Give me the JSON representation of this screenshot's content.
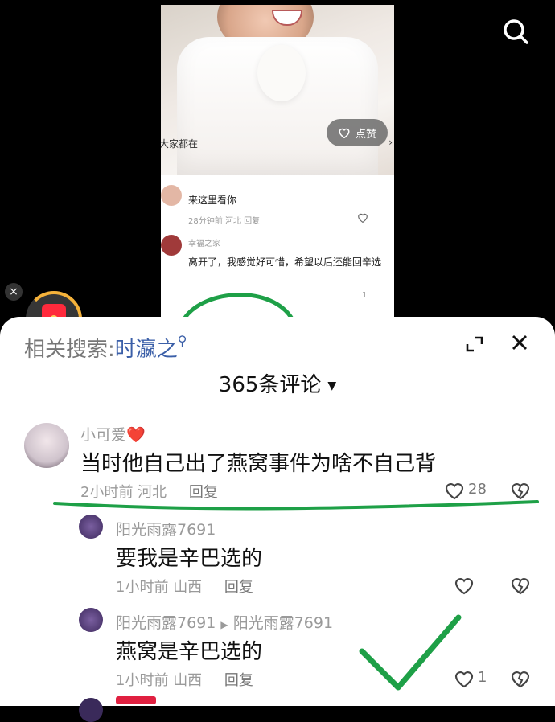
{
  "video": {
    "like_label": "点赞",
    "everyone_text": "大家都在",
    "mini_comments": [
      {
        "text": "来这里看你",
        "meta": "28分钟前 河北 回复"
      },
      {
        "user": "幸福之家",
        "text": "离开了，我感觉好可惜，希望以后还能回辛选",
        "meta": "1",
        "like_count": "1"
      }
    ]
  },
  "sheet": {
    "related_label": "相关搜索:",
    "related_keyword": "时瀛之",
    "comment_count_title": "365条评论"
  },
  "comments": [
    {
      "user": "小可爱❤️",
      "text": "当时他自己出了燕窝事件为啥不自己背",
      "time": "2小时前",
      "location": "河北",
      "reply_label": "回复",
      "likes": "28"
    },
    {
      "user": "阳光雨露7691",
      "text": "要我是辛巴选的",
      "time": "1小时前",
      "location": "山西",
      "reply_label": "回复",
      "likes": ""
    },
    {
      "user": "阳光雨露7691",
      "reply_to": "阳光雨露7691",
      "text": "燕窝是辛巴选的",
      "time": "1小时前",
      "location": "山西",
      "reply_label": "回复",
      "likes": "1"
    }
  ],
  "colors": {
    "accent_blue": "#3b5fa8",
    "annotation_green": "#1ea047",
    "redpacket_red": "#ff2a3c"
  },
  "icons": [
    "search-icon",
    "close-icon",
    "expand-icon",
    "heart-icon",
    "dislike-icon",
    "red-packet-icon",
    "caret-down-icon"
  ]
}
